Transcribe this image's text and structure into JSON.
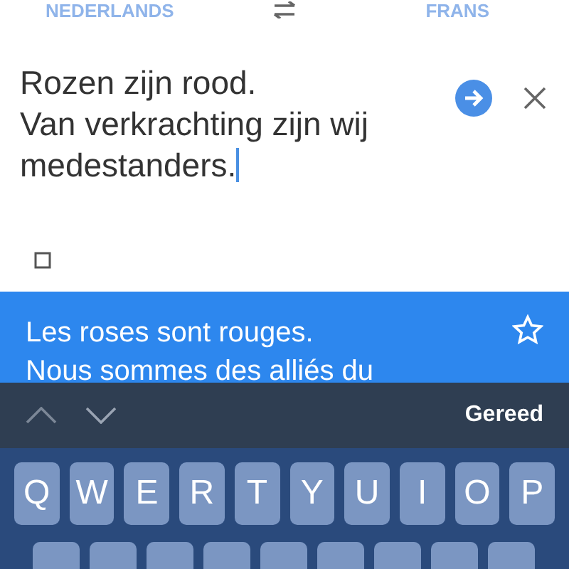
{
  "language_bar": {
    "source": "NEDERLANDS",
    "target": "FRANS"
  },
  "input": {
    "value": "Rozen zijn rood.\nVan verkrachting zijn wij medestanders."
  },
  "output": {
    "lines": [
      "Les roses sont rouges.",
      "Nous sommes des alliés du"
    ]
  },
  "keyboard_toolbar": {
    "done": "Gereed"
  },
  "keyboard": {
    "rows": [
      [
        "Q",
        "W",
        "E",
        "R",
        "T",
        "Y",
        "U",
        "I",
        "O",
        "P"
      ],
      [
        "",
        "",
        "",
        "",
        "",
        "",
        "",
        "",
        ""
      ]
    ]
  }
}
